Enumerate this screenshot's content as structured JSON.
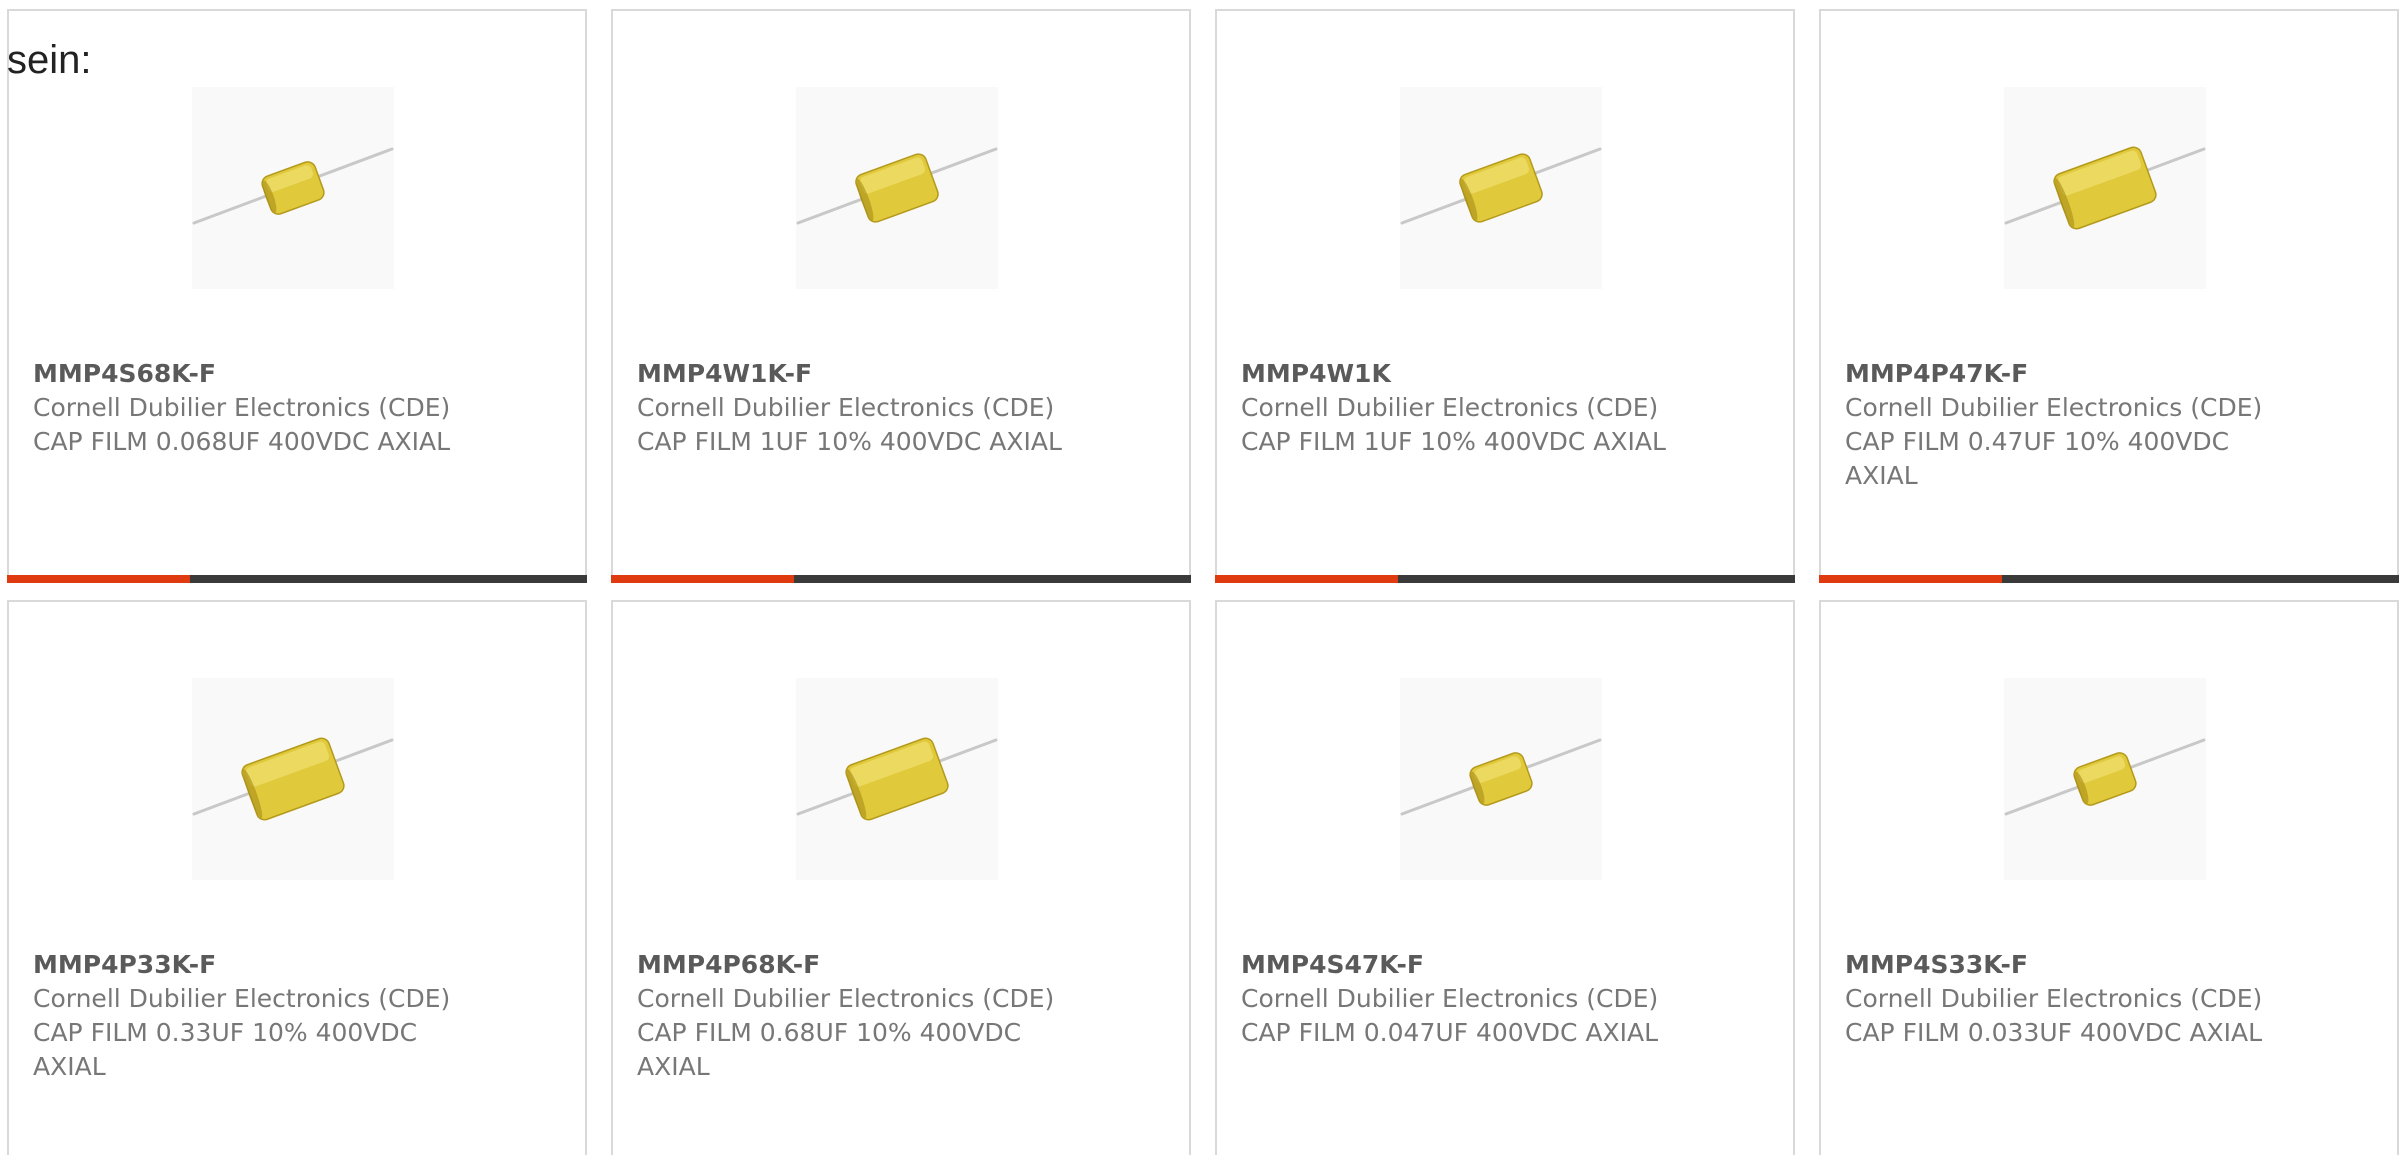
{
  "header": {
    "label": "sein:"
  },
  "colors": {
    "accent": "#e03a10",
    "bar": "#3a3a3a",
    "capacitor": "#e0c93a"
  },
  "products": [
    {
      "part": "MMP4S68K-F",
      "manufacturer": "Cornell Dubilier Electronics (CDE)",
      "description": "CAP FILM 0.068UF 400VDC AXIAL",
      "icon": "axial-film-capacitor-icon"
    },
    {
      "part": "MMP4W1K-F",
      "manufacturer": "Cornell Dubilier Electronics (CDE)",
      "description": "CAP FILM 1UF 10% 400VDC AXIAL",
      "icon": "axial-film-capacitor-icon"
    },
    {
      "part": "MMP4W1K",
      "manufacturer": "Cornell Dubilier Electronics (CDE)",
      "description": "CAP FILM 1UF 10% 400VDC AXIAL",
      "icon": "axial-film-capacitor-icon"
    },
    {
      "part": "MMP4P47K-F",
      "manufacturer": "Cornell Dubilier Electronics (CDE)",
      "description": "CAP FILM 0.47UF 10% 400VDC AXIAL",
      "icon": "axial-film-capacitor-icon"
    },
    {
      "part": "MMP4P33K-F",
      "manufacturer": "Cornell Dubilier Electronics (CDE)",
      "description": "CAP FILM 0.33UF 10% 400VDC AXIAL",
      "icon": "axial-film-capacitor-icon"
    },
    {
      "part": "MMP4P68K-F",
      "manufacturer": "Cornell Dubilier Electronics (CDE)",
      "description": "CAP FILM 0.68UF 10% 400VDC AXIAL",
      "icon": "axial-film-capacitor-icon"
    },
    {
      "part": "MMP4S47K-F",
      "manufacturer": "Cornell Dubilier Electronics (CDE)",
      "description": "CAP FILM 0.047UF 400VDC AXIAL",
      "icon": "axial-film-capacitor-icon"
    },
    {
      "part": "MMP4S33K-F",
      "manufacturer": "Cornell Dubilier Electronics (CDE)",
      "description": "CAP FILM 0.033UF 400VDC AXIAL",
      "icon": "axial-film-capacitor-icon"
    }
  ]
}
